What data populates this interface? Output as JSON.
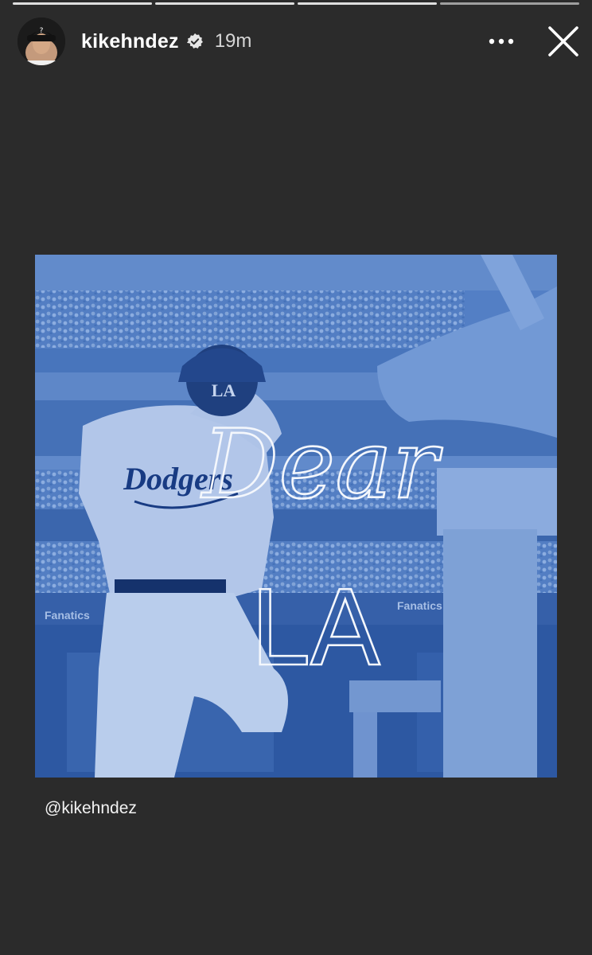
{
  "progress": {
    "segments": 4,
    "active_index": 3
  },
  "header": {
    "username": "kikehndez",
    "timestamp": "19m",
    "avatar_icon": "user-avatar",
    "verified_icon": "verified-badge-icon",
    "more_icon": "more-options-icon",
    "close_icon": "close-icon"
  },
  "post": {
    "overlay_line1": "Dear",
    "overlay_line2": "LA",
    "jersey_text": "Dodgers",
    "cap_logo": "LA",
    "ad_text": "Fanatics",
    "tint_color": "#3f6fb8"
  },
  "caption": {
    "mention": "@kikehndez"
  }
}
